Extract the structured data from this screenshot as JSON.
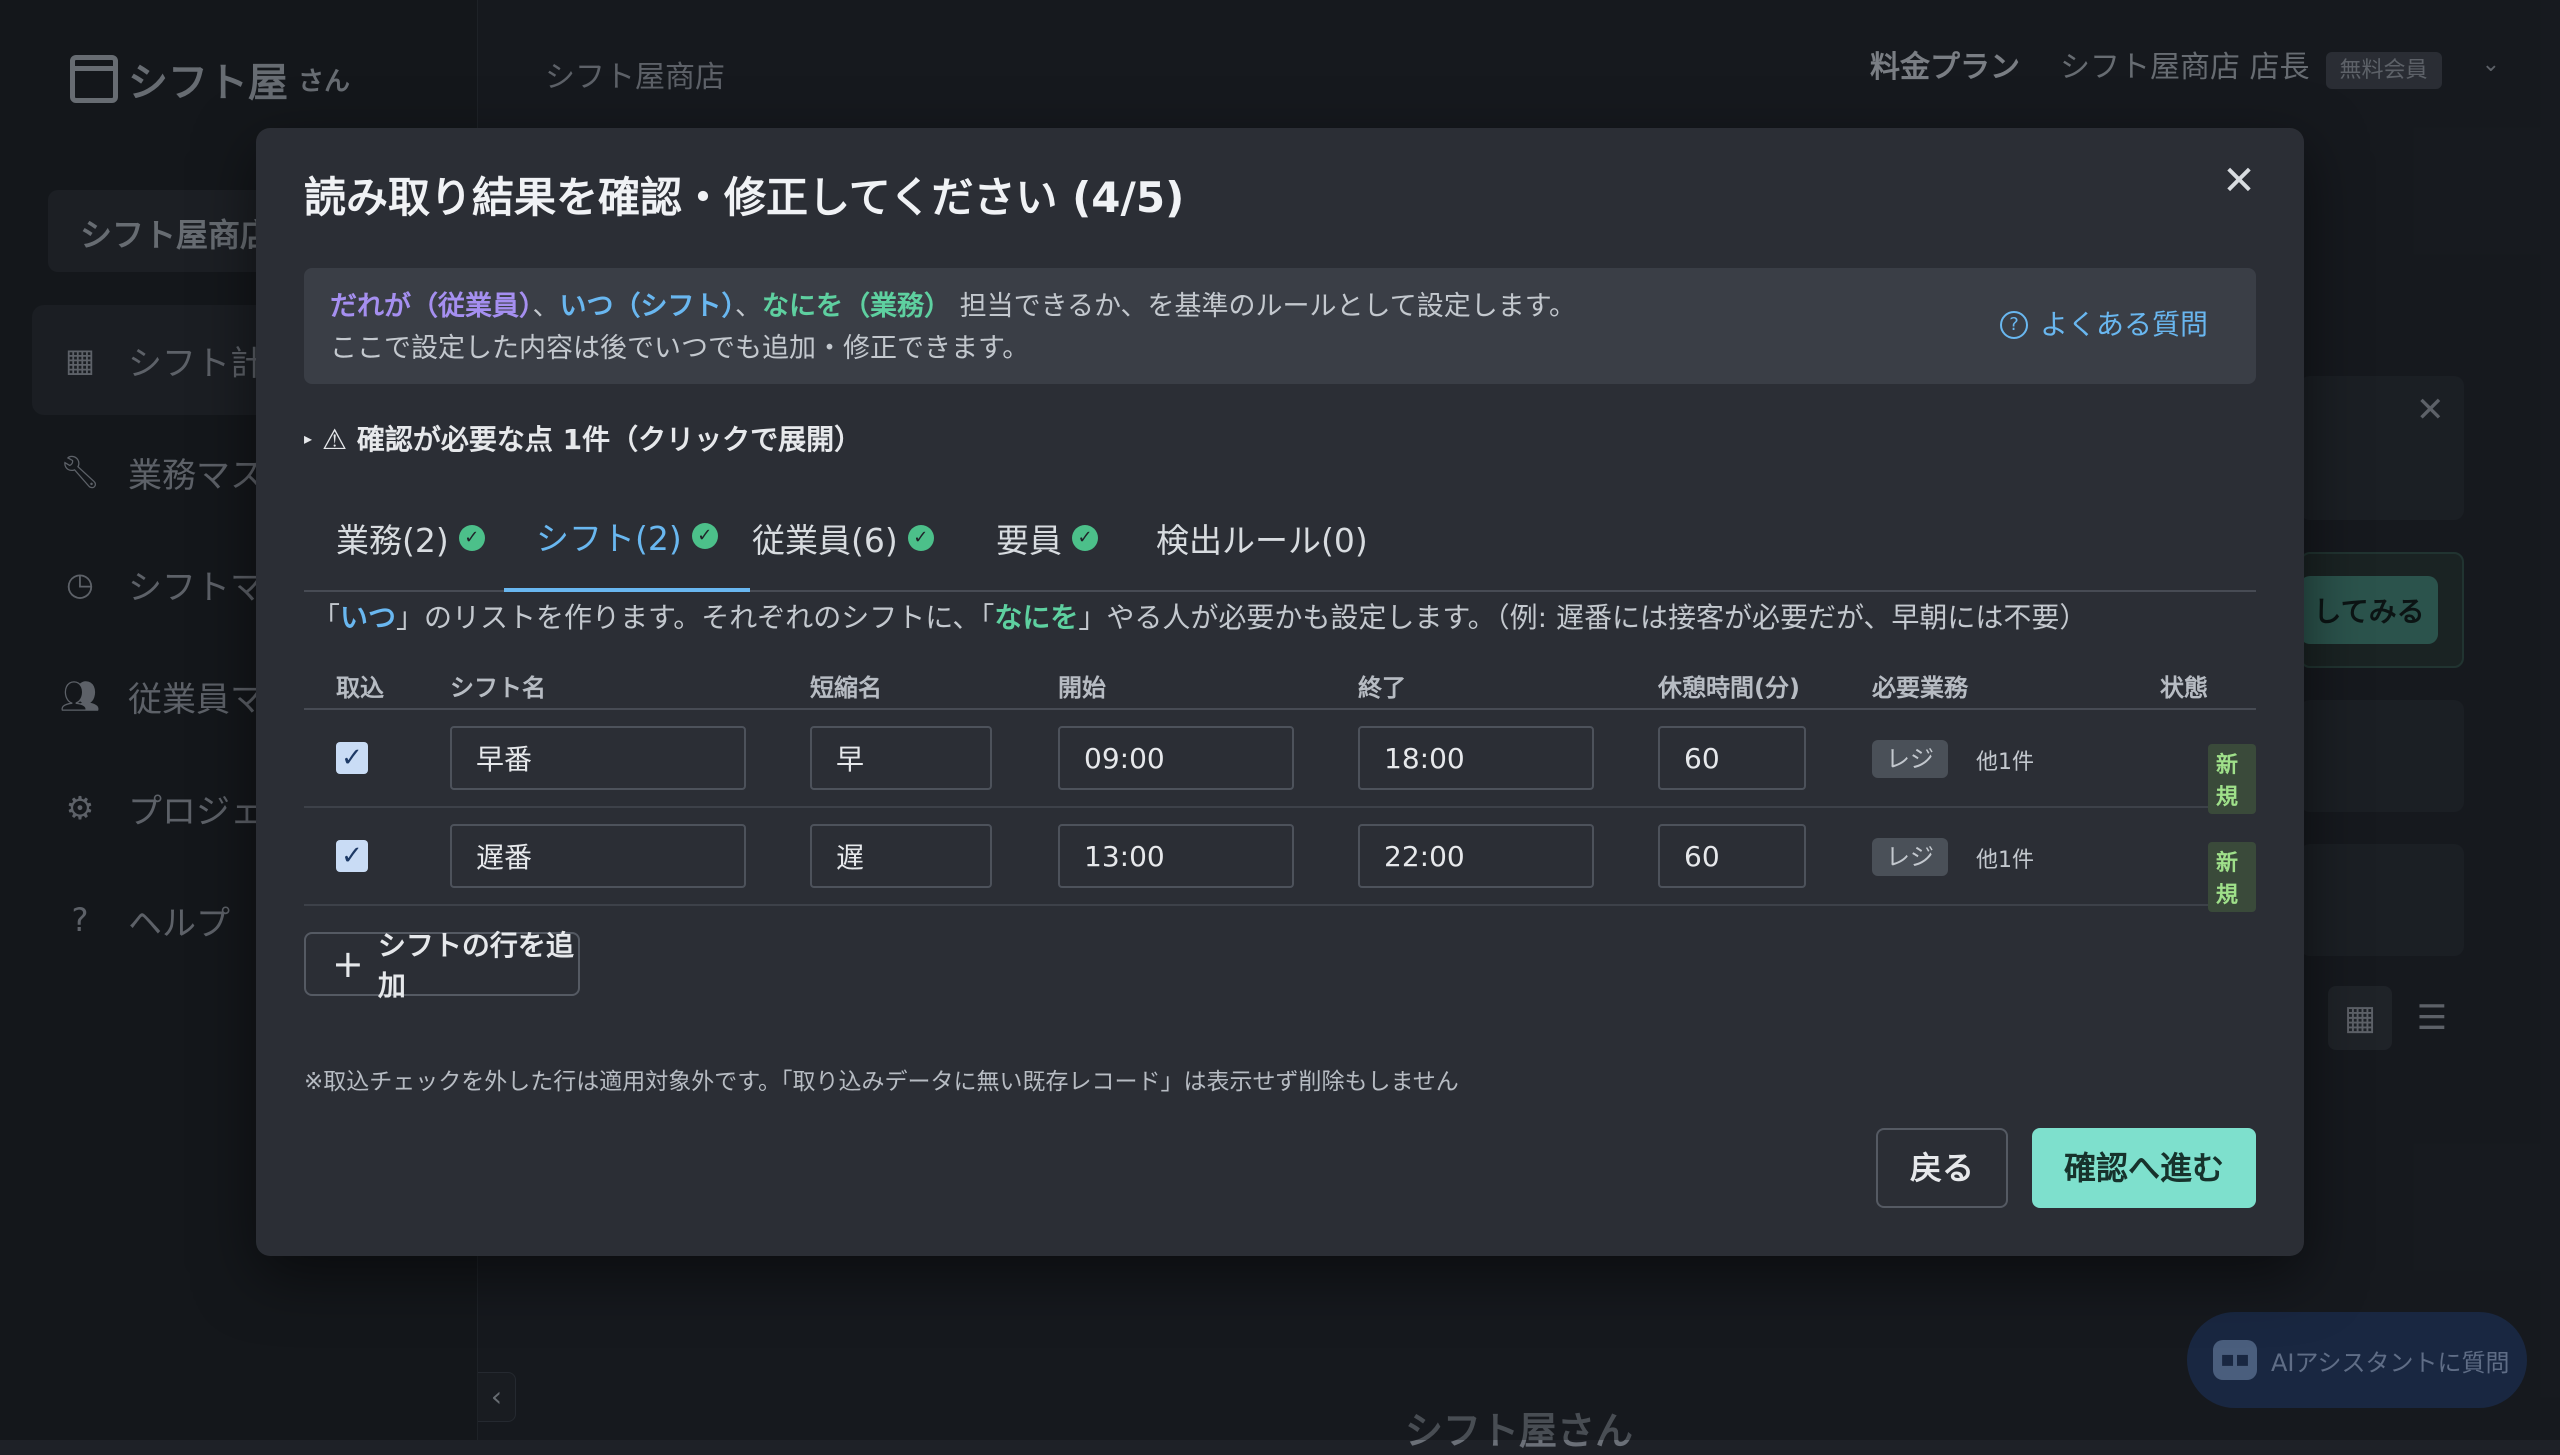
{
  "app": {
    "logo_text": "シフト屋",
    "logo_suffix": "さん",
    "store_name": "シフト屋商店",
    "sidebar_store_box": "シフト屋商店",
    "sidebar": [
      {
        "label": "シフト計",
        "icon": "calendar-icon"
      },
      {
        "label": "業務マス",
        "icon": "wrench-icon"
      },
      {
        "label": "シフトマ",
        "icon": "clock-icon"
      },
      {
        "label": "従業員マ",
        "icon": "users-icon"
      },
      {
        "label": "プロジェ",
        "icon": "gear-icon"
      },
      {
        "label": "ヘルプ",
        "icon": "help-icon"
      }
    ],
    "topbar": {
      "plan_link": "料金プラン",
      "user": "シフト屋商店 店長",
      "member_badge": "無料会員"
    },
    "bg_button": "してみる",
    "ai_button": "AIアシスタントに質問",
    "footer_logo": "シフト屋さん"
  },
  "modal": {
    "title": "読み取り結果を確認・修正してください (4/5)",
    "info": {
      "who": "だれが（従業員）",
      "sep1": "、",
      "when": "いつ（シフト）",
      "sep2": "、",
      "what": "なにを（業務）",
      "rest": "担当できるか、を基準のルールとして設定します。",
      "line2": "ここで設定した内容は後でいつでも追加・修正できます。"
    },
    "faq_link": "よくある質問",
    "warning": "⚠ 確認が必要な点 1件（クリックで展開）",
    "tabs": [
      {
        "label": "業務(2)",
        "checked": true
      },
      {
        "label": "シフト(2)",
        "checked": true,
        "active": true
      },
      {
        "label": "従業員(6)",
        "checked": true
      },
      {
        "label": "要員",
        "checked": true
      },
      {
        "label": "検出ルール(0)",
        "checked": false
      }
    ],
    "description": {
      "q1_open": "「",
      "when": "いつ",
      "q1_close": "」のリストを作ります。それぞれのシフトに、「",
      "what": "なにを",
      "rest": "」やる人が必要かも設定します。（例: 遅番には接客が必要だが、早朝には不要）"
    },
    "table": {
      "columns": [
        "取込",
        "シフト名",
        "短縮名",
        "開始",
        "終了",
        "休憩時間(分)",
        "必要業務",
        "状態"
      ],
      "rows": [
        {
          "import": true,
          "name": "早番",
          "short": "早",
          "start": "09:00",
          "end": "18:00",
          "break": "60",
          "task": "レジ",
          "others": "他1件",
          "status": "新規"
        },
        {
          "import": true,
          "name": "遅番",
          "short": "遅",
          "start": "13:00",
          "end": "22:00",
          "break": "60",
          "task": "レジ",
          "others": "他1件",
          "status": "新規"
        }
      ]
    },
    "add_row_button": "シフトの行を追加",
    "note": "※取込チェックを外した行は適用対象外です。「取り込みデータに無い既存レコード」は表示せず削除もしません",
    "back_button": "戻る",
    "next_button": "確認へ進む"
  },
  "colors": {
    "accent_blue": "#69b7f0",
    "accent_green": "#5ed0a0",
    "accent_purple": "#a58ff0",
    "primary_button": "#7ee0cd"
  }
}
